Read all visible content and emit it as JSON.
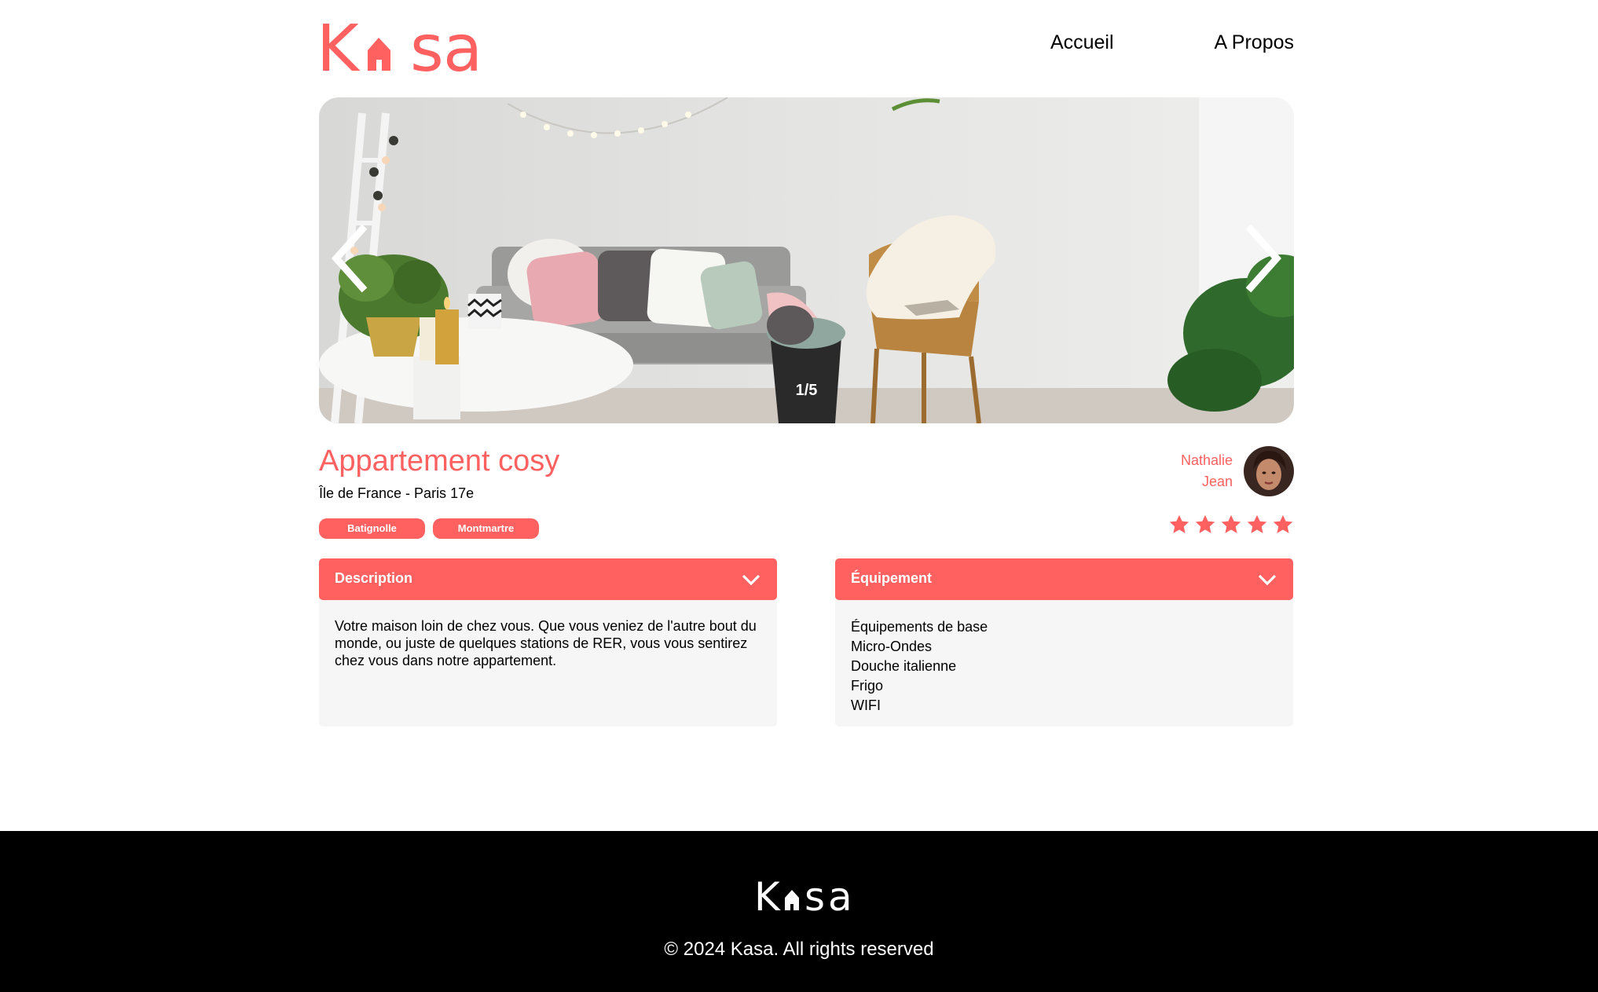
{
  "brand": {
    "logo_text": "Kasa",
    "accent_color": "#FF6060"
  },
  "nav": {
    "home": "Accueil",
    "about": "A Propos"
  },
  "carousel": {
    "counter": "1/5",
    "prev_icon": "chevron-left-icon",
    "next_icon": "chevron-right-icon"
  },
  "listing": {
    "title": "Appartement cosy",
    "location": "Île de France - Paris 17e",
    "tags": [
      "Batignolle",
      "Montmartre"
    ],
    "host": {
      "first_name": "Nathalie",
      "last_name": "Jean"
    },
    "rating": 5,
    "rating_max": 5
  },
  "collapses": {
    "description": {
      "title": "Description",
      "text": "Votre maison loin de chez vous. Que vous veniez de l'autre bout du monde, ou juste de quelques stations de RER, vous vous sentirez chez vous dans notre appartement."
    },
    "equipment": {
      "title": "Équipement",
      "items": [
        "Équipements de base",
        "Micro-Ondes",
        "Douche italienne",
        "Frigo",
        "WIFI"
      ]
    }
  },
  "footer": {
    "logo_text": "Kasa",
    "copyright": "© 2024 Kasa. All rights reserved"
  }
}
